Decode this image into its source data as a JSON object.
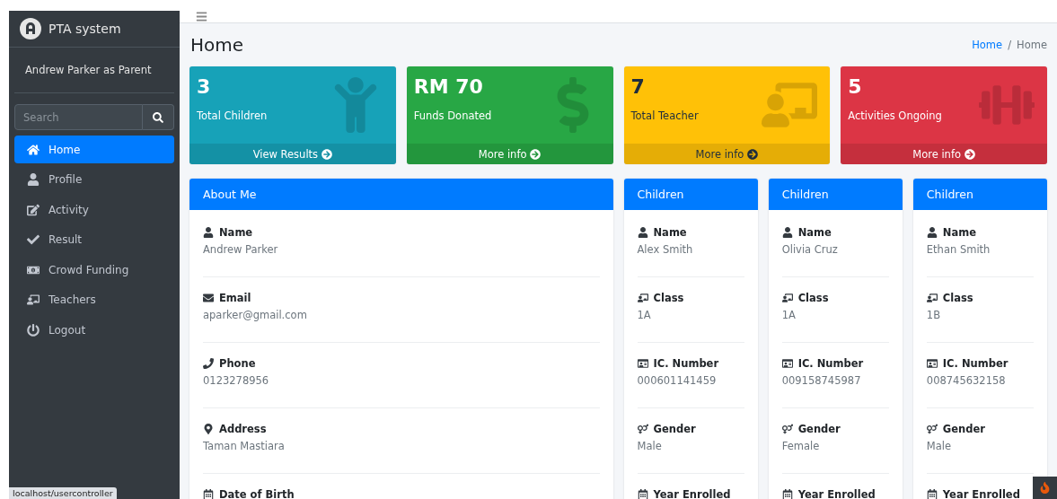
{
  "brand": {
    "title": "PTA system"
  },
  "user_panel": {
    "text": "Andrew Parker as Parent"
  },
  "search": {
    "placeholder": "Search"
  },
  "nav": [
    {
      "label": "Home",
      "kind": "home",
      "selected": true
    },
    {
      "label": "Profile",
      "kind": "profile",
      "selected": false
    },
    {
      "label": "Activity",
      "kind": "activity",
      "selected": false
    },
    {
      "label": "Result",
      "kind": "result",
      "selected": false
    },
    {
      "label": "Crowd Funding",
      "kind": "funding",
      "selected": false
    },
    {
      "label": "Teachers",
      "kind": "teachers",
      "selected": false
    },
    {
      "label": "Logout",
      "kind": "logout",
      "selected": false
    }
  ],
  "page_title": "Home",
  "breadcrumb": [
    {
      "label": "Home",
      "link": true
    },
    {
      "label": "/",
      "link": false
    },
    {
      "label": "Home",
      "link": false
    }
  ],
  "stat_boxes": [
    {
      "value": "3",
      "label": "Total Children",
      "link": "View Results",
      "kind": "children",
      "color": "#17a2b8"
    },
    {
      "value": "RM 70",
      "label": "Funds Donated",
      "link": "More info",
      "kind": "funds",
      "color": "#28a745"
    },
    {
      "value": "7",
      "label": "Total Teacher",
      "link": "More info",
      "kind": "teachers",
      "color": "#ffc107"
    },
    {
      "value": "5",
      "label": "Activities Ongoing",
      "link": "More info",
      "kind": "activities",
      "color": "#dc3545"
    }
  ],
  "about_me": {
    "title": "About Me",
    "fields": [
      {
        "kind": "name",
        "label": "Name",
        "value": "Andrew Parker"
      },
      {
        "kind": "email",
        "label": "Email",
        "value": "aparker@gmail.com"
      },
      {
        "kind": "phone",
        "label": "Phone",
        "value": "0123278956"
      },
      {
        "kind": "address",
        "label": "Address",
        "value": "Taman Mastiara"
      },
      {
        "kind": "date",
        "label": "Date of Birth"
      }
    ]
  },
  "children": [
    {
      "title": "Children",
      "fields": [
        {
          "kind": "name",
          "label": "Name",
          "value": "Alex Smith"
        },
        {
          "kind": "class",
          "label": "Class",
          "value": "1A"
        },
        {
          "kind": "ic",
          "label": "IC. Number",
          "value": "000601141459"
        },
        {
          "kind": "gender",
          "label": "Gender",
          "value": "Male"
        },
        {
          "kind": "date",
          "label": "Year Enrolled"
        }
      ]
    },
    {
      "title": "Children",
      "fields": [
        {
          "kind": "name",
          "label": "Name",
          "value": "Olivia Cruz"
        },
        {
          "kind": "class",
          "label": "Class",
          "value": "1A"
        },
        {
          "kind": "ic",
          "label": "IC. Number",
          "value": "009158745987"
        },
        {
          "kind": "gender",
          "label": "Gender",
          "value": "Female"
        },
        {
          "kind": "date",
          "label": "Year Enrolled"
        }
      ]
    },
    {
      "title": "Children",
      "fields": [
        {
          "kind": "name",
          "label": "Name",
          "value": "Ethan Smith"
        },
        {
          "kind": "class",
          "label": "Class",
          "value": "1B"
        },
        {
          "kind": "ic",
          "label": "IC. Number",
          "value": "008745632158"
        },
        {
          "kind": "gender",
          "label": "Gender",
          "value": "Male"
        },
        {
          "kind": "date",
          "label": "Year Enrolled"
        }
      ]
    }
  ],
  "status_url": "localhost/usercontroller"
}
